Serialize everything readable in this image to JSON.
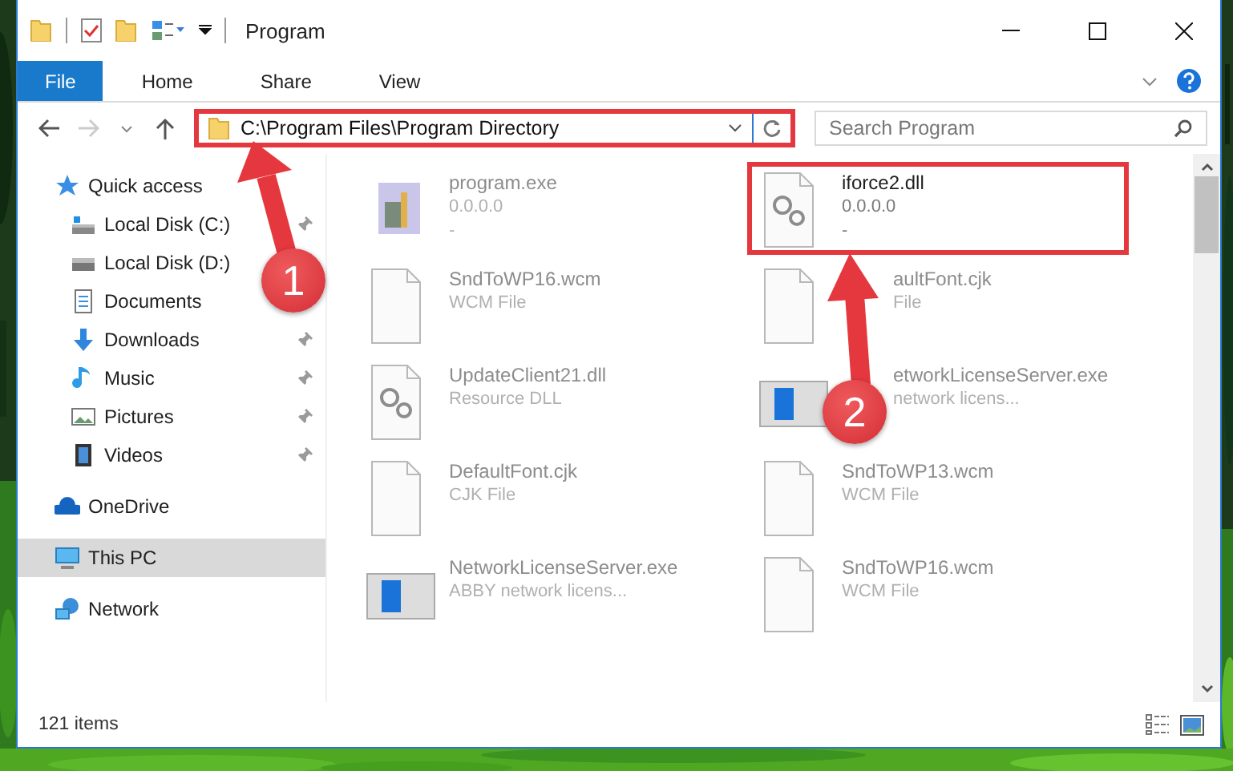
{
  "window": {
    "title": "Program"
  },
  "ribbon": {
    "tabs": [
      {
        "label": "File",
        "kind": "file"
      },
      {
        "label": "Home",
        "kind": "tab"
      },
      {
        "label": "Share",
        "kind": "tab"
      },
      {
        "label": "View",
        "kind": "tab"
      }
    ]
  },
  "address_bar": {
    "path": "C:\\Program Files\\Program Directory",
    "highlighted": true
  },
  "search": {
    "placeholder": "Search Program"
  },
  "sidebar": {
    "items": [
      {
        "label": "Quick access",
        "selected": false,
        "children": [
          {
            "label": "Local Disk (C:)",
            "pinned": true,
            "selected": false
          },
          {
            "label": "Local Disk (D:)",
            "pinned": false,
            "selected": false
          },
          {
            "label": "Documents",
            "pinned": false,
            "selected": false
          },
          {
            "label": "Downloads",
            "pinned": true,
            "selected": false
          },
          {
            "label": "Music",
            "pinned": true,
            "selected": false
          },
          {
            "label": "Pictures",
            "pinned": true,
            "selected": false
          },
          {
            "label": "Videos",
            "pinned": true,
            "selected": false
          }
        ]
      },
      {
        "label": "OneDrive",
        "selected": false
      },
      {
        "label": "This PC",
        "selected": true
      },
      {
        "label": "Network",
        "selected": false
      }
    ]
  },
  "files": [
    {
      "name": "program.exe",
      "details": [
        "0.0.0.0",
        "-"
      ],
      "blurred": true,
      "highlighted": false,
      "covered": false
    },
    {
      "name": "iforce2.dll",
      "details": [
        "0.0.0.0",
        "-"
      ],
      "blurred": false,
      "highlighted": true,
      "covered": false
    },
    {
      "name": "SndToWP16.wcm",
      "details": [
        "WCM File"
      ],
      "blurred": true,
      "highlighted": false,
      "covered": false
    },
    {
      "name": "aultFont.cjk",
      "details": [
        "File"
      ],
      "blurred": true,
      "highlighted": false,
      "covered": true
    },
    {
      "name": "UpdateClient21.dll",
      "details": [
        "Resource DLL"
      ],
      "blurred": true,
      "highlighted": false,
      "covered": false
    },
    {
      "name": "etworkLicenseServer.exe",
      "details": [
        "network licens..."
      ],
      "blurred": true,
      "highlighted": false,
      "covered": true
    },
    {
      "name": "DefaultFont.cjk",
      "details": [
        "CJK File"
      ],
      "blurred": true,
      "highlighted": false,
      "covered": false
    },
    {
      "name": "SndToWP13.wcm",
      "details": [
        "WCM File"
      ],
      "blurred": true,
      "highlighted": false,
      "covered": false
    },
    {
      "name": "NetworkLicenseServer.exe",
      "details": [
        "ABBY network licens..."
      ],
      "blurred": true,
      "highlighted": false,
      "covered": false
    },
    {
      "name": "SndToWP16.wcm",
      "details": [
        "WCM File"
      ],
      "blurred": true,
      "highlighted": false,
      "covered": false
    }
  ],
  "status_bar": {
    "item_count": "121 items"
  },
  "annotations": [
    {
      "label": "1"
    },
    {
      "label": "2"
    }
  ]
}
